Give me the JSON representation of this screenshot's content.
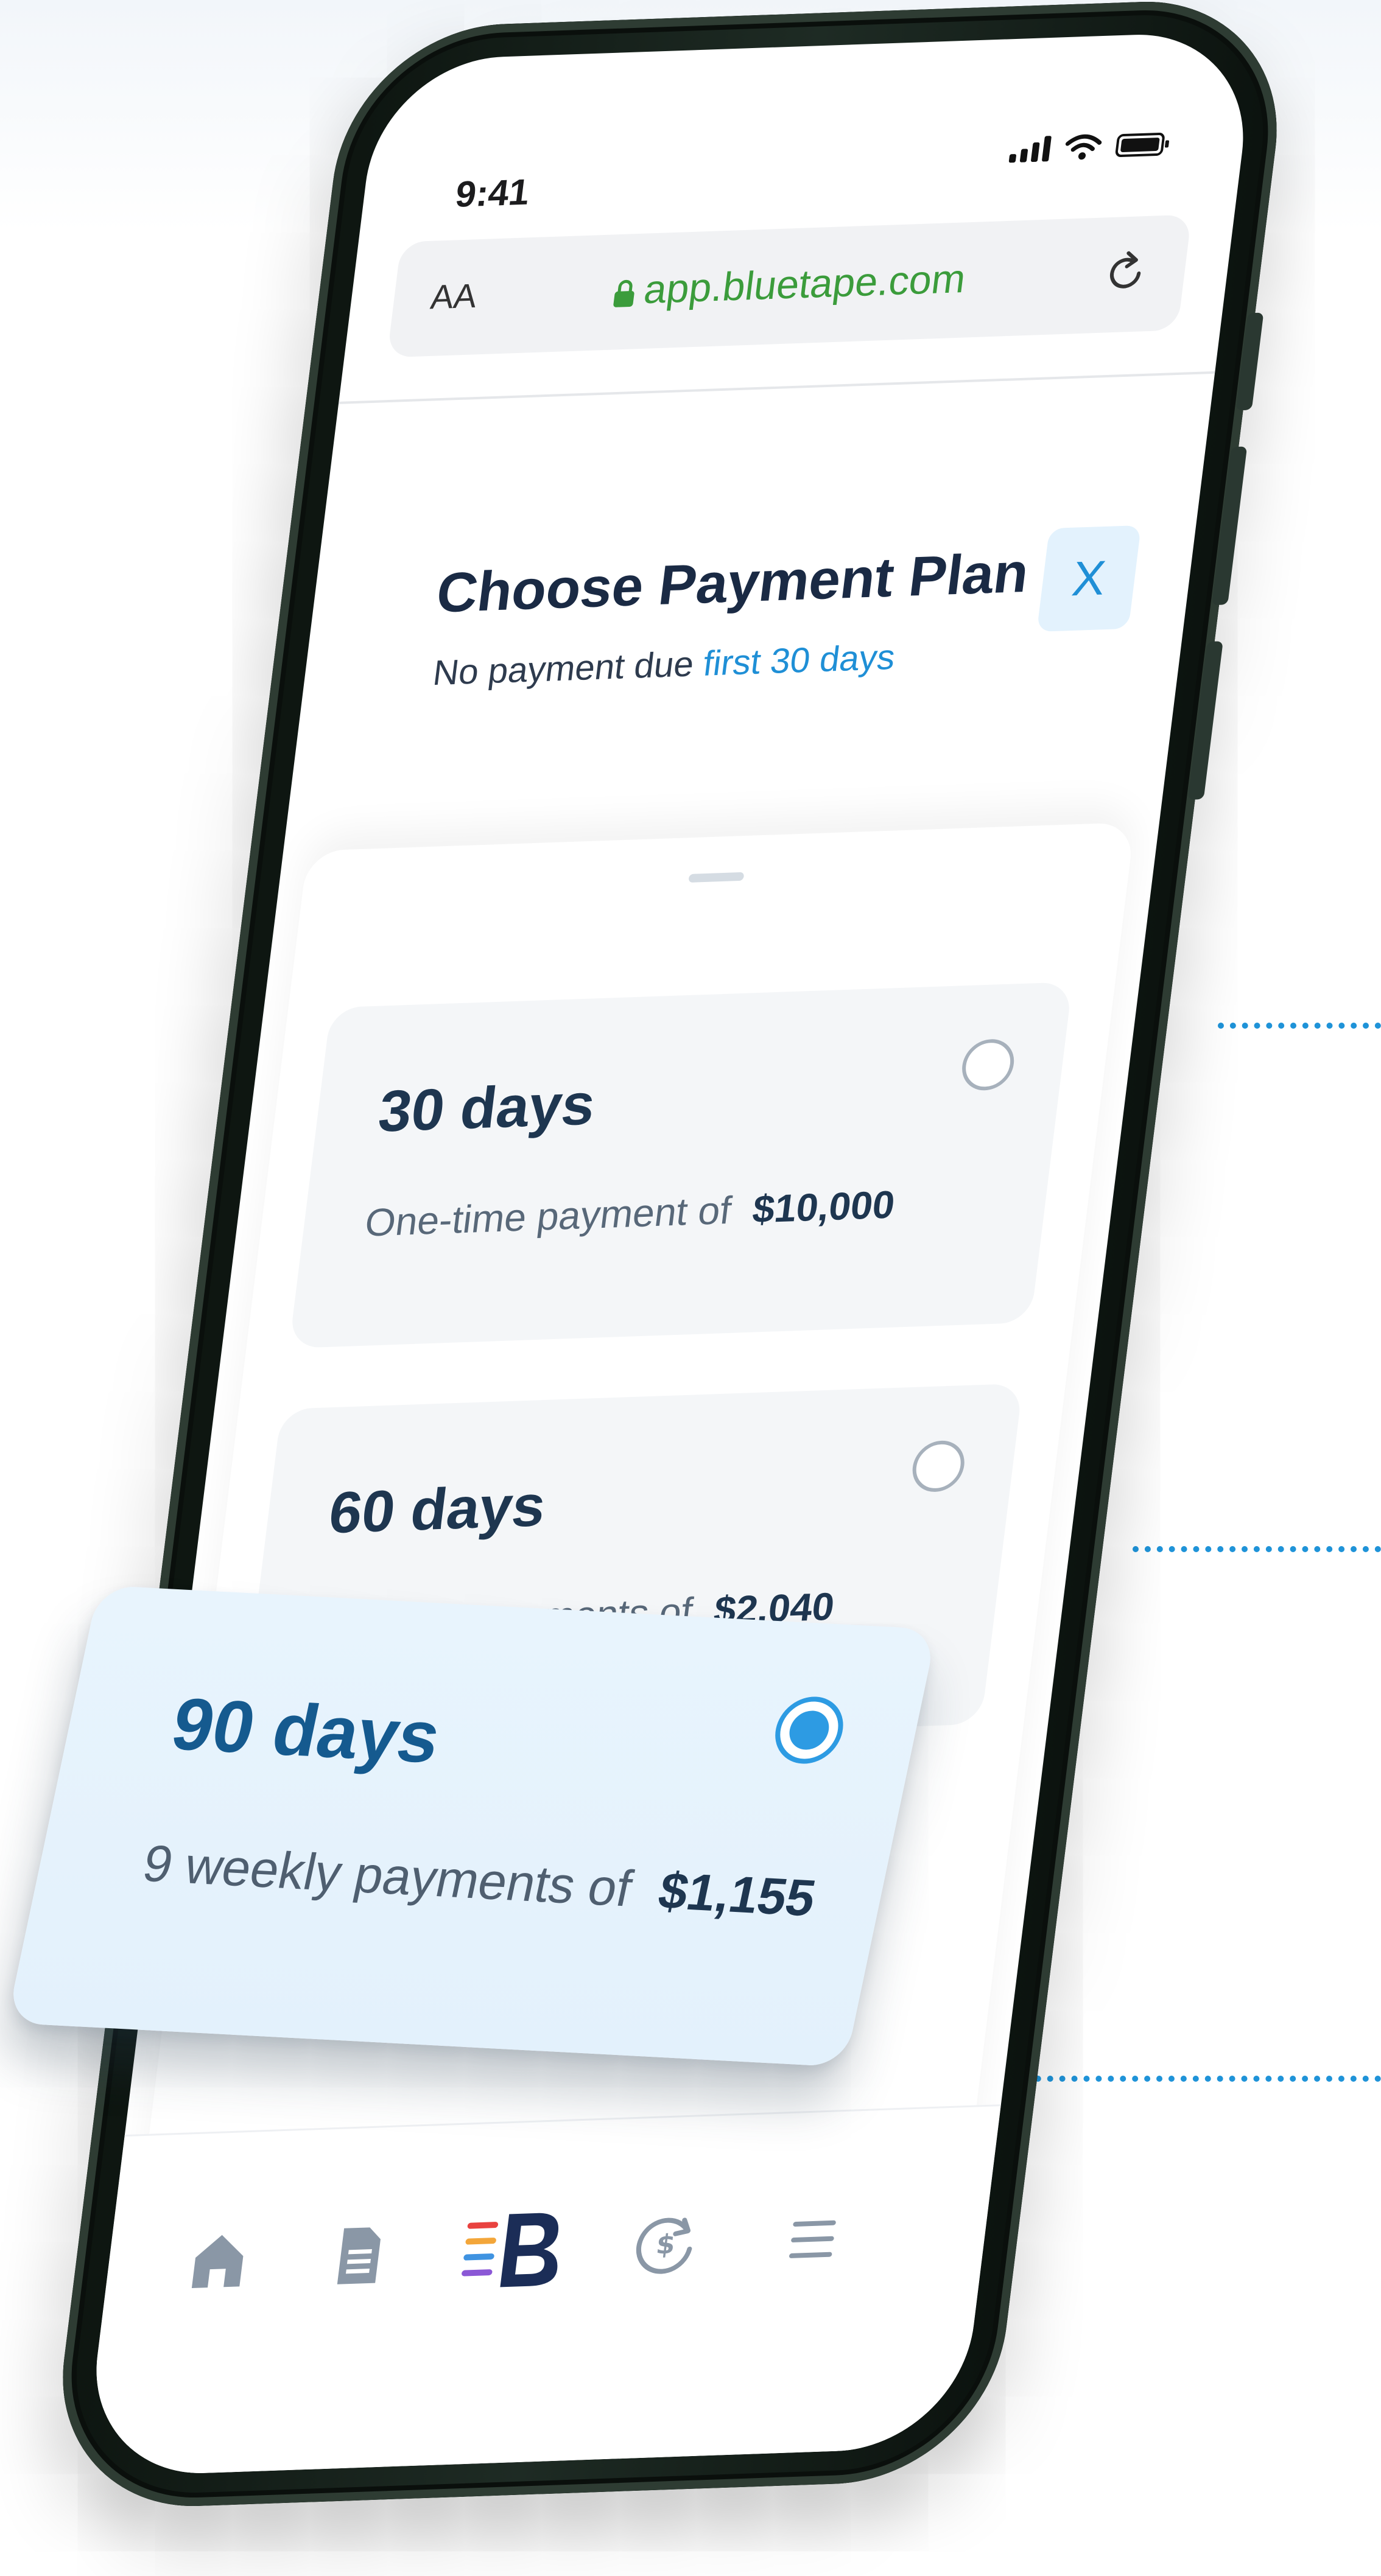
{
  "status_bar": {
    "time": "9:41"
  },
  "browser": {
    "text_size_label": "AA",
    "url": "app.bluetape.com"
  },
  "payment_plan": {
    "title": "Choose Payment Plan",
    "subtitle_prefix": "No payment due",
    "subtitle_highlight": "first 30 days",
    "close_label": "X"
  },
  "plans": [
    {
      "days": "30 days",
      "description": "One-time payment of",
      "amount": "$10,000",
      "selected": false
    },
    {
      "days": "60 days",
      "description": "5 weekly payments of",
      "amount": "$2,040",
      "selected": false
    },
    {
      "days": "90 days",
      "description": "9 weekly payments of",
      "amount": "$1,155",
      "selected": true
    }
  ],
  "tab_bar": {
    "items": [
      {
        "name": "home-icon"
      },
      {
        "name": "document-icon"
      },
      {
        "name": "bluetape-logo-icon"
      },
      {
        "name": "payments-icon"
      },
      {
        "name": "menu-icon"
      }
    ]
  },
  "colors": {
    "accent": "#1f8fd6",
    "url_green": "#3b9c3b",
    "heading": "#1a2a44",
    "phone_body": "#1e2b24",
    "selected_card": "#e6f3fd"
  }
}
